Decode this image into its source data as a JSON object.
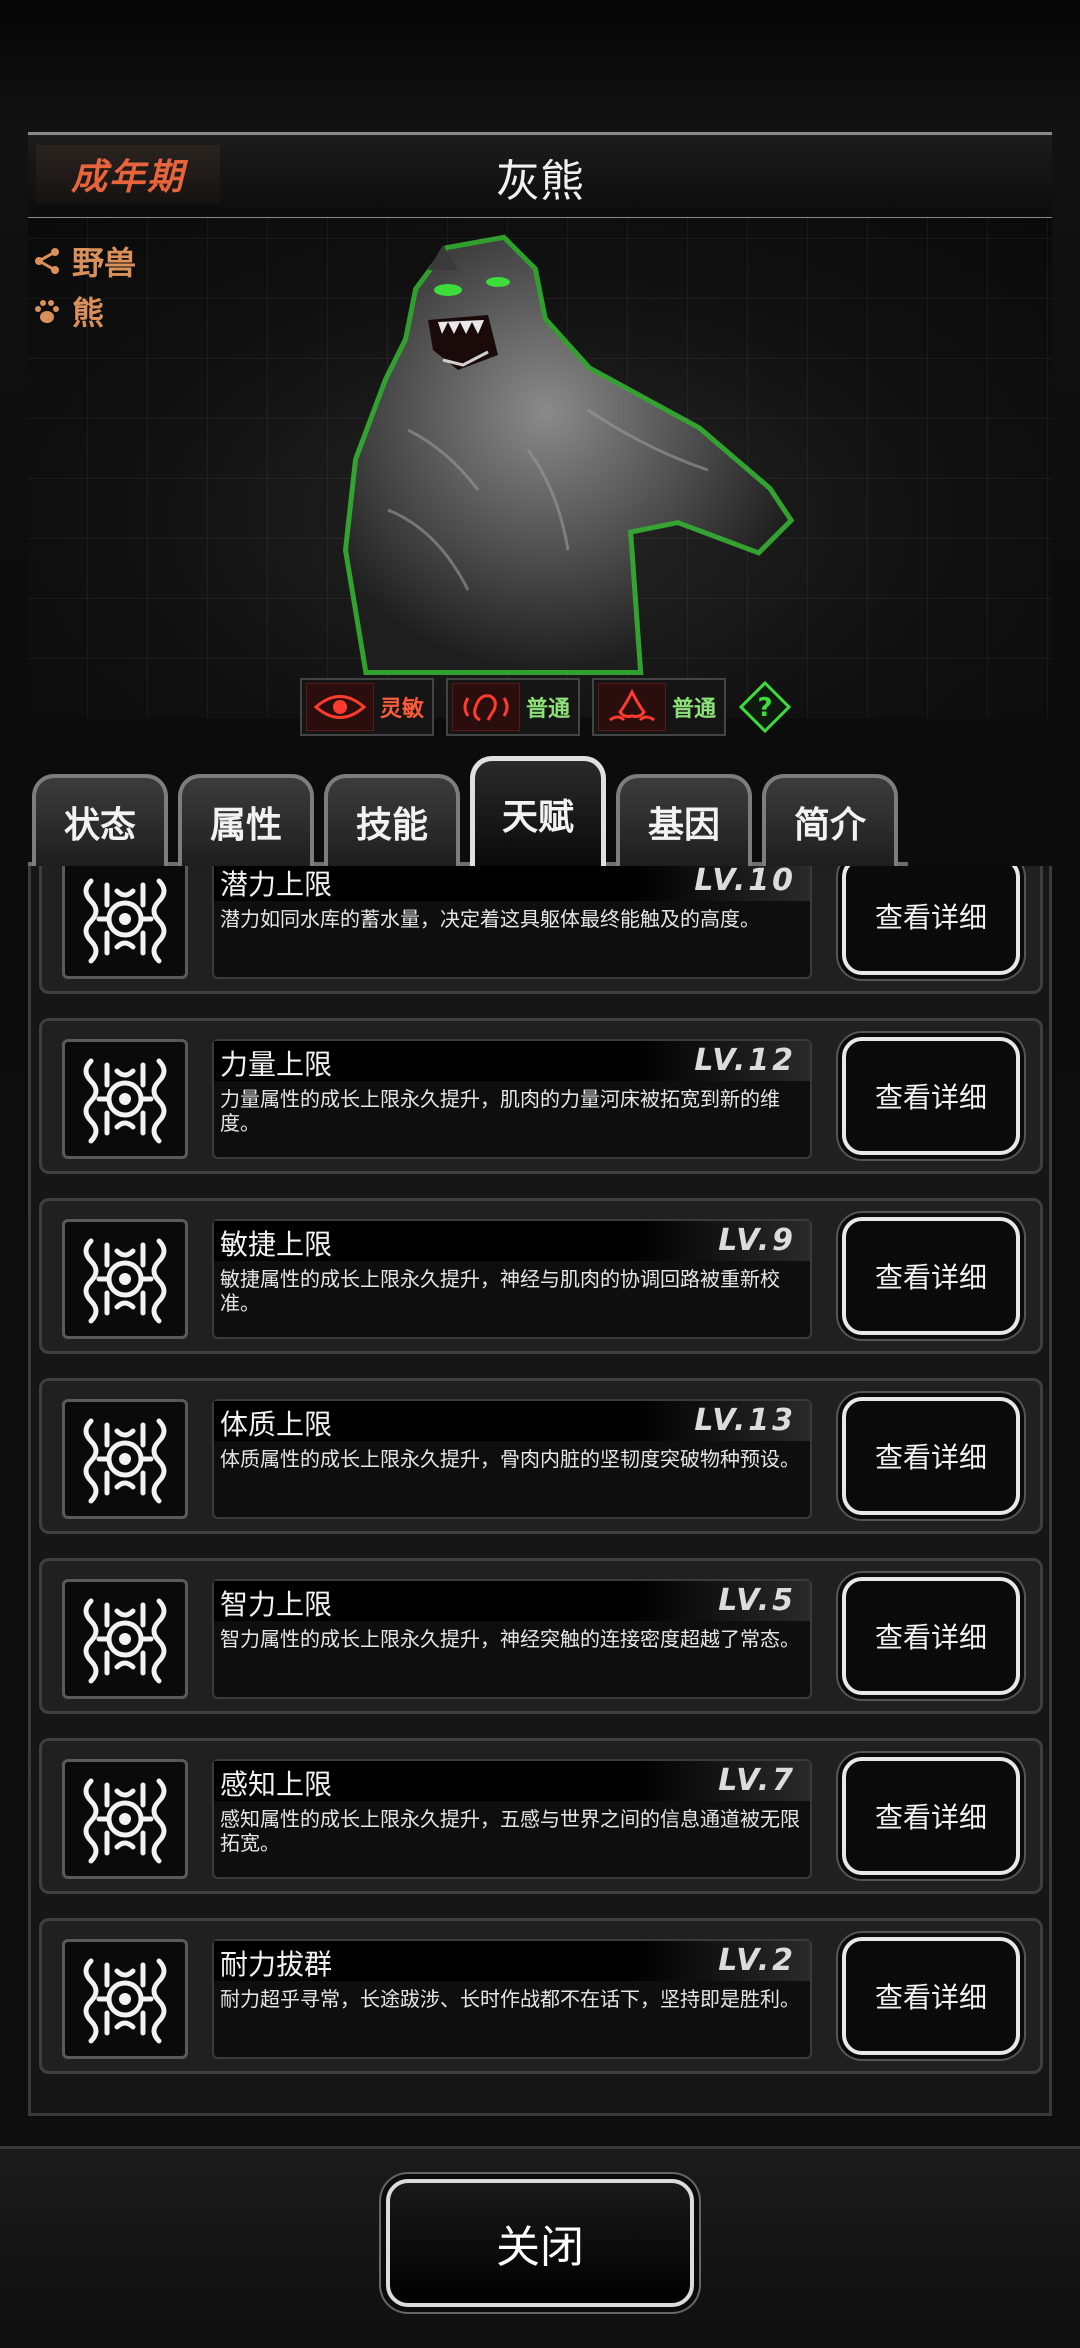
{
  "header": {
    "stage": "成年期",
    "name": "灰熊"
  },
  "tags": [
    {
      "icon": "branch-icon",
      "label": "野兽"
    },
    {
      "icon": "paw-icon",
      "label": "熊"
    }
  ],
  "senses": [
    {
      "icon": "eye-icon",
      "label": "灵敏",
      "color": "#ff5a3c"
    },
    {
      "icon": "ear-icon",
      "label": "普通",
      "color": "#8fe07a"
    },
    {
      "icon": "nose-icon",
      "label": "普通",
      "color": "#8fe07a"
    }
  ],
  "tabs": [
    {
      "label": "状态",
      "active": false
    },
    {
      "label": "属性",
      "active": false
    },
    {
      "label": "技能",
      "active": false
    },
    {
      "label": "天赋",
      "active": true
    },
    {
      "label": "基因",
      "active": false
    },
    {
      "label": "简介",
      "active": false
    }
  ],
  "talents": [
    {
      "name": "潜力上限",
      "level": "LV.10",
      "desc": "潜力如同水库的蓄水量，决定着这具躯体最终能触及的高度。",
      "button": "查看详细"
    },
    {
      "name": "力量上限",
      "level": "LV.12",
      "desc": "力量属性的成长上限永久提升，肌肉的力量河床被拓宽到新的维度。",
      "button": "查看详细"
    },
    {
      "name": "敏捷上限",
      "level": "LV.9",
      "desc": "敏捷属性的成长上限永久提升，神经与肌肉的协调回路被重新校准。",
      "button": "查看详细"
    },
    {
      "name": "体质上限",
      "level": "LV.13",
      "desc": "体质属性的成长上限永久提升，骨肉内脏的坚韧度突破物种预设。",
      "button": "查看详细"
    },
    {
      "name": "智力上限",
      "level": "LV.5",
      "desc": "智力属性的成长上限永久提升，神经突触的连接密度超越了常态。",
      "button": "查看详细"
    },
    {
      "name": "感知上限",
      "level": "LV.7",
      "desc": "感知属性的成长上限永久提升，五感与世界之间的信息通道被无限拓宽。",
      "button": "查看详细"
    },
    {
      "name": "耐力拔群",
      "level": "LV.2",
      "desc": "耐力超乎寻常，长途跋涉、长时作战都不在话下，坚持即是胜利。",
      "button": "查看详细"
    }
  ],
  "footer": {
    "close_label": "关闭"
  },
  "colors": {
    "stage_text": "#e8643c",
    "tag_text": "#d9905a",
    "glow": "#3ddc3a"
  }
}
